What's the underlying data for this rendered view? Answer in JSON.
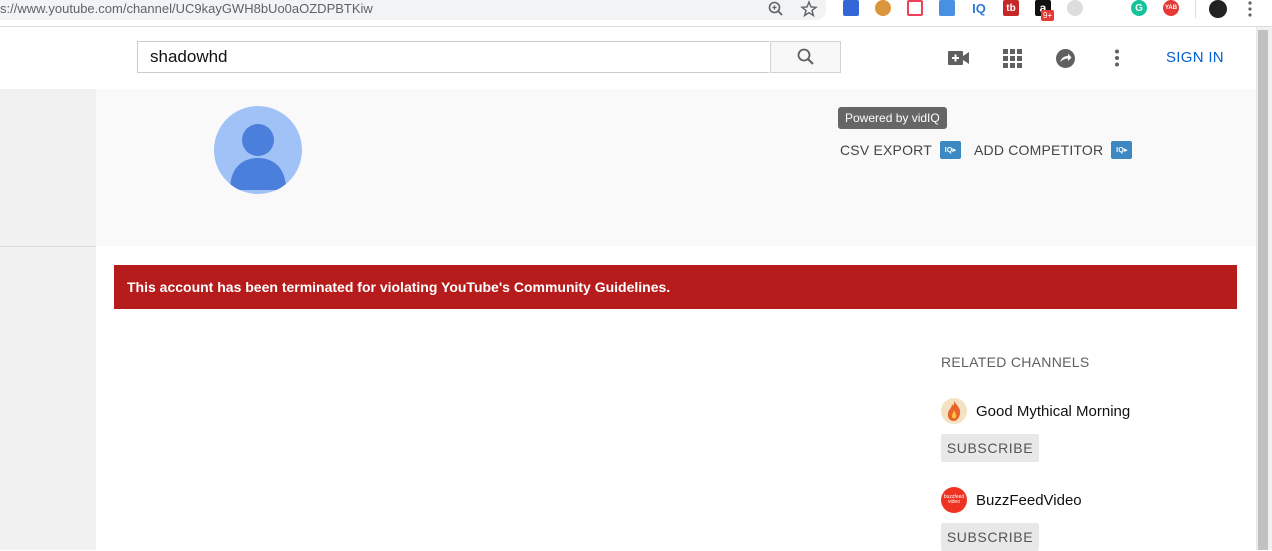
{
  "browser": {
    "url": "s://www.youtube.com/channel/UC9kayGWH8bUo0aOZDPBTKiw",
    "extensions": [
      {
        "name": "bookmark-ext-icon",
        "label": "",
        "color": "#3367d6"
      },
      {
        "name": "cookie-ext-icon",
        "label": "",
        "color": "#d9963b"
      },
      {
        "name": "pocket-ext-icon",
        "label": "",
        "color": "#ee4056"
      },
      {
        "name": "translate-ext-icon",
        "label": "",
        "color": "#4a90e2"
      },
      {
        "name": "vidiq-ext-icon",
        "label": "IQ",
        "color": "#2b7bd6"
      },
      {
        "name": "tubebuddy-ext-icon",
        "label": "tb",
        "color": "#c62828"
      },
      {
        "name": "amazon-ext-icon",
        "label": "a",
        "color": "#111111"
      },
      {
        "name": "gray-ext-icon",
        "label": "",
        "color": "#cccccc"
      },
      {
        "name": "grammarly-ext-icon",
        "label": "G",
        "color": "#15c39a"
      },
      {
        "name": "yab-ext-icon",
        "label": "YAB",
        "color": "#e53935"
      },
      {
        "name": "profile-ext-icon",
        "label": "",
        "color": "#222222"
      }
    ],
    "amazon_badge": "9+"
  },
  "header": {
    "search_value": "shadowhd",
    "sign_in": "SIGN IN"
  },
  "channel": {
    "vidiq_tooltip": "Powered by vidIQ",
    "csv_export": "CSV EXPORT",
    "add_competitor": "ADD COMPETITOR",
    "iq_badge": "IQ▸"
  },
  "main": {
    "terminated_message": "This account has been terminated for violating YouTube's Community Guidelines."
  },
  "related": {
    "title": "RELATED CHANNELS",
    "channels": [
      {
        "name": "Good Mythical Morning",
        "subscribe": "SUBSCRIBE"
      },
      {
        "name": "BuzzFeedVideo",
        "subscribe": "SUBSCRIBE",
        "avatar_text": "buzzfeed video"
      }
    ]
  },
  "colors": {
    "banner": "#b71c1c",
    "sign_in": "#065fd4",
    "avatar_bg": "#a0c2f7",
    "avatar_fg": "#4a7fdc"
  }
}
